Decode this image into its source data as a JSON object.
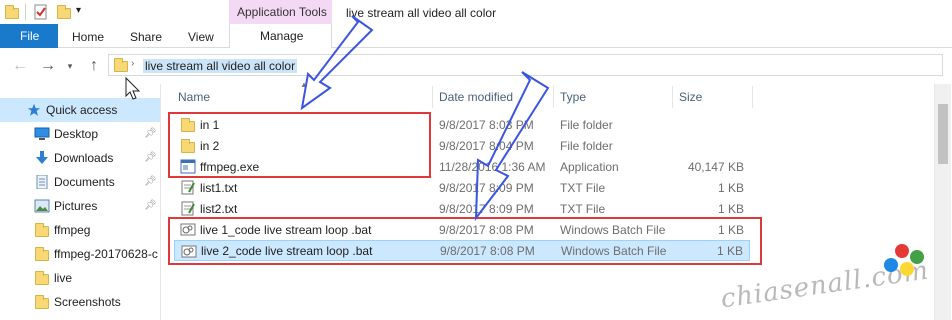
{
  "window": {
    "title": "live stream all video all color",
    "context_tab_group": "Application Tools"
  },
  "ribbon": {
    "tabs": [
      "File",
      "Home",
      "Share",
      "View"
    ],
    "context_tab": "Manage"
  },
  "address": {
    "path": "live stream all video all color"
  },
  "nav_pane": {
    "items": [
      {
        "label": "Quick access",
        "icon": "star-icon",
        "selected": true,
        "pinned": false
      },
      {
        "label": "Desktop",
        "icon": "desktop-icon",
        "selected": false,
        "pinned": true
      },
      {
        "label": "Downloads",
        "icon": "download-icon",
        "selected": false,
        "pinned": true
      },
      {
        "label": "Documents",
        "icon": "document-icon",
        "selected": false,
        "pinned": true
      },
      {
        "label": "Pictures",
        "icon": "pictures-icon",
        "selected": false,
        "pinned": true
      },
      {
        "label": "ffmpeg",
        "icon": "folder-icon",
        "selected": false,
        "pinned": false
      },
      {
        "label": "ffmpeg-20170628-c",
        "icon": "folder-icon",
        "selected": false,
        "pinned": false
      },
      {
        "label": "live",
        "icon": "folder-icon",
        "selected": false,
        "pinned": false
      },
      {
        "label": "Screenshots",
        "icon": "folder-icon",
        "selected": false,
        "pinned": false
      }
    ]
  },
  "columns": {
    "name": "Name",
    "date": "Date modified",
    "type": "Type",
    "size": "Size"
  },
  "files": [
    {
      "name": "in 1",
      "date": "9/8/2017 8:03 PM",
      "type": "File folder",
      "size": "",
      "icon": "folder-icon"
    },
    {
      "name": "in 2",
      "date": "9/8/2017 8:04 PM",
      "type": "File folder",
      "size": "",
      "icon": "folder-icon"
    },
    {
      "name": "ffmpeg.exe",
      "date": "11/28/2016 1:36 AM",
      "type": "Application",
      "size": "40,147 KB",
      "icon": "exe-icon"
    },
    {
      "name": "list1.txt",
      "date": "9/8/2017 8:09 PM",
      "type": "TXT File",
      "size": "1 KB",
      "icon": "text-file-icon"
    },
    {
      "name": "list2.txt",
      "date": "9/8/2017 8:09 PM",
      "type": "TXT File",
      "size": "1 KB",
      "icon": "text-file-icon"
    },
    {
      "name": "live 1_code live stream loop .bat",
      "date": "9/8/2017 8:08 PM",
      "type": "Windows Batch File",
      "size": "1 KB",
      "icon": "batch-file-icon"
    },
    {
      "name": "live 2_code live stream loop .bat",
      "date": "9/8/2017 8:08 PM",
      "type": "Windows Batch File",
      "size": "1 KB",
      "icon": "batch-file-icon",
      "selected": true
    }
  ],
  "watermark": {
    "text": "chiasenall.com",
    "dot_colors": [
      "#e53935",
      "#43a047",
      "#1e88e5",
      "#fdd835"
    ]
  },
  "colors": {
    "file_tab": "#1979ca",
    "context_tab": "#f4d9f5",
    "selection": "#cce8ff",
    "highlight_box": "#e0383a",
    "annotation_arrow": "#3b55e0"
  }
}
